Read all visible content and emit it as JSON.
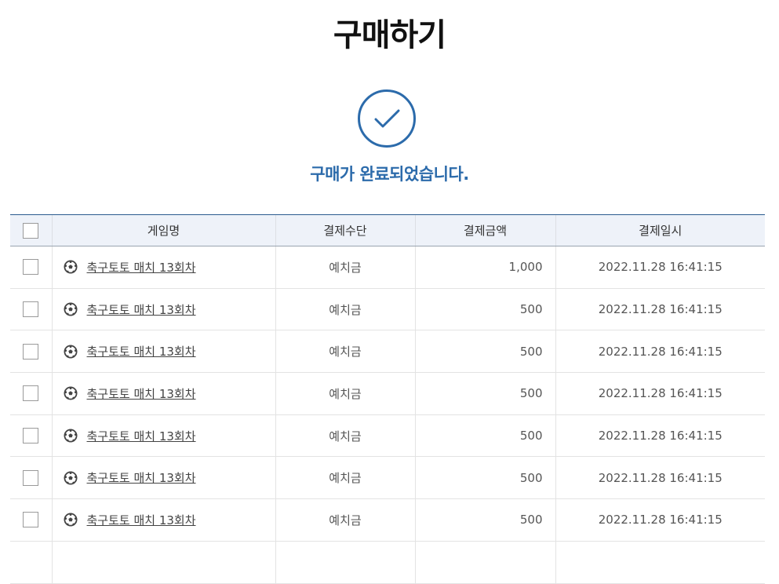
{
  "page": {
    "title": "구매하기",
    "complete_message": "구매가 완료되었습니다."
  },
  "icons": {
    "status": "check-circle-icon",
    "game": "soccer-ball-icon"
  },
  "colors": {
    "accent": "#2c6bab",
    "header_bg": "#eef2f9"
  },
  "table": {
    "headers": [
      "게임명",
      "결제수단",
      "결제금액",
      "결제일시"
    ],
    "rows": [
      {
        "game": "축구토토 매치 13회차",
        "method": "예치금",
        "amount": "1,000",
        "date": "2022.11.28 16:41:15"
      },
      {
        "game": "축구토토 매치 13회차",
        "method": "예치금",
        "amount": "500",
        "date": "2022.11.28 16:41:15"
      },
      {
        "game": "축구토토 매치 13회차",
        "method": "예치금",
        "amount": "500",
        "date": "2022.11.28 16:41:15"
      },
      {
        "game": "축구토토 매치 13회차",
        "method": "예치금",
        "amount": "500",
        "date": "2022.11.28 16:41:15"
      },
      {
        "game": "축구토토 매치 13회차",
        "method": "예치금",
        "amount": "500",
        "date": "2022.11.28 16:41:15"
      },
      {
        "game": "축구토토 매치 13회차",
        "method": "예치금",
        "amount": "500",
        "date": "2022.11.28 16:41:15"
      },
      {
        "game": "축구토토 매치 13회차",
        "method": "예치금",
        "amount": "500",
        "date": "2022.11.28 16:41:15"
      },
      {
        "game": "",
        "method": "",
        "amount": "",
        "date": ""
      }
    ]
  }
}
